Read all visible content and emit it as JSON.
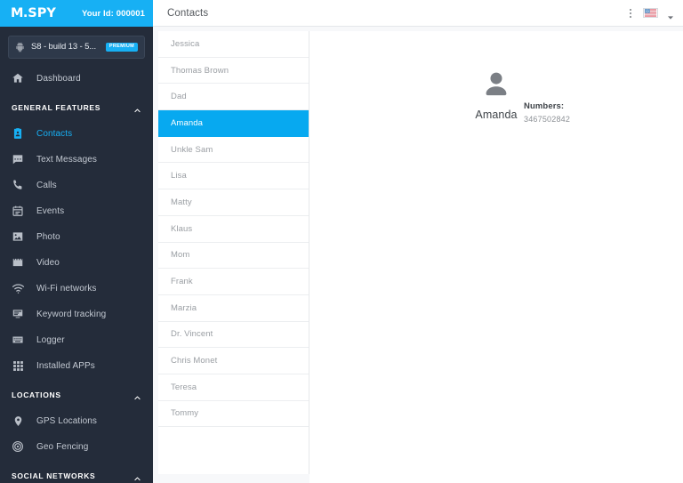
{
  "brand": {
    "logo_mark": "M.",
    "logo_text": "SPY",
    "account_id_label": "Your Id: 000001",
    "accent_color": "#17b0f4",
    "sidebar_bg": "#242c3a"
  },
  "device": {
    "name": "S8 - build 13 - 5...",
    "badge": "PREMIUM",
    "platform_icon": "android-icon"
  },
  "sidebar": {
    "dashboard": {
      "label": "Dashboard",
      "icon": "home-icon"
    },
    "sections": [
      {
        "title": "GENERAL FEATURES",
        "items": [
          {
            "label": "Contacts",
            "icon": "contact-card-icon",
            "active": true
          },
          {
            "label": "Text Messages",
            "icon": "message-bubble-icon",
            "active": false
          },
          {
            "label": "Calls",
            "icon": "phone-icon",
            "active": false
          },
          {
            "label": "Events",
            "icon": "calendar-icon",
            "active": false
          },
          {
            "label": "Photo",
            "icon": "image-icon",
            "active": false
          },
          {
            "label": "Video",
            "icon": "film-icon",
            "active": false
          },
          {
            "label": "Wi-Fi networks",
            "icon": "wifi-icon",
            "active": false
          },
          {
            "label": "Keyword tracking",
            "icon": "monitor-icon",
            "active": false
          },
          {
            "label": "Logger",
            "icon": "keyboard-icon",
            "active": false
          },
          {
            "label": "Installed APPs",
            "icon": "grid-icon",
            "active": false
          }
        ]
      },
      {
        "title": "LOCATIONS",
        "items": [
          {
            "label": "GPS Locations",
            "icon": "map-pin-icon",
            "active": false
          },
          {
            "label": "Geo Fencing",
            "icon": "target-icon",
            "active": false
          }
        ]
      },
      {
        "title": "SOCIAL NETWORKS",
        "items": []
      }
    ]
  },
  "topbar": {
    "page_title": "Contacts",
    "overflow_icon": "more-vertical-icon",
    "language_flag": "us-flag-icon",
    "language_chevron": "chevron-down-icon"
  },
  "contacts": {
    "items": [
      "Jessica",
      "Thomas Brown",
      "Dad",
      "Amanda",
      "Unkle Sam",
      "Lisa",
      "Matty",
      "Klaus",
      "Mom",
      "Frank",
      "Marzia",
      "Dr. Vincent",
      "Chris Monet",
      "Teresa",
      "Tommy"
    ],
    "selected_index": 3,
    "selected_color": "#07a9f0"
  },
  "detail": {
    "avatar_icon": "user-avatar-icon",
    "name": "Amanda",
    "numbers_label": "Numbers:",
    "numbers": "3467502842"
  }
}
